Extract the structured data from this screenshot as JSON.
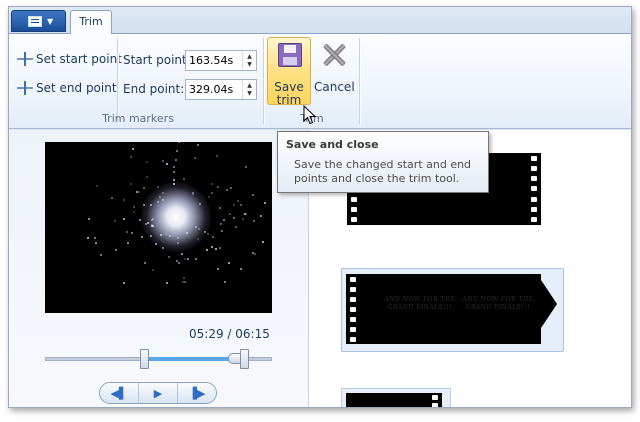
{
  "tabs": {
    "app_menu": "application-menu",
    "active": "Trim"
  },
  "ribbon": {
    "set_start_point": "Set start point",
    "set_end_point": "Set end point",
    "start_point_label": "Start point:",
    "start_point_value": "163.54s",
    "end_point_label": "End point:",
    "end_point_value": "329.04s",
    "group_trim_markers": "Trim markers",
    "save_trim_line1": "Save",
    "save_trim_line2": "trim",
    "cancel": "Cancel",
    "group_trim": "Trim"
  },
  "tooltip": {
    "title": "Save and close",
    "body_line1": "Save the changed start and end",
    "body_line2": "points and close the trim tool."
  },
  "player": {
    "time_readout": "05:29 / 06:15",
    "trim_start_fraction": 0.436,
    "trim_end_fraction": 0.877,
    "playhead_fraction": 0.84
  },
  "storyboard": {
    "clip_caption_line1": "AND NOW FOR THE",
    "clip_caption_line2": "GRAND FINALE!!!"
  },
  "colors": {
    "accent": "#2f6dc3",
    "selection_range": "#5aa6e6",
    "save_highlight": "#ffd45c"
  }
}
